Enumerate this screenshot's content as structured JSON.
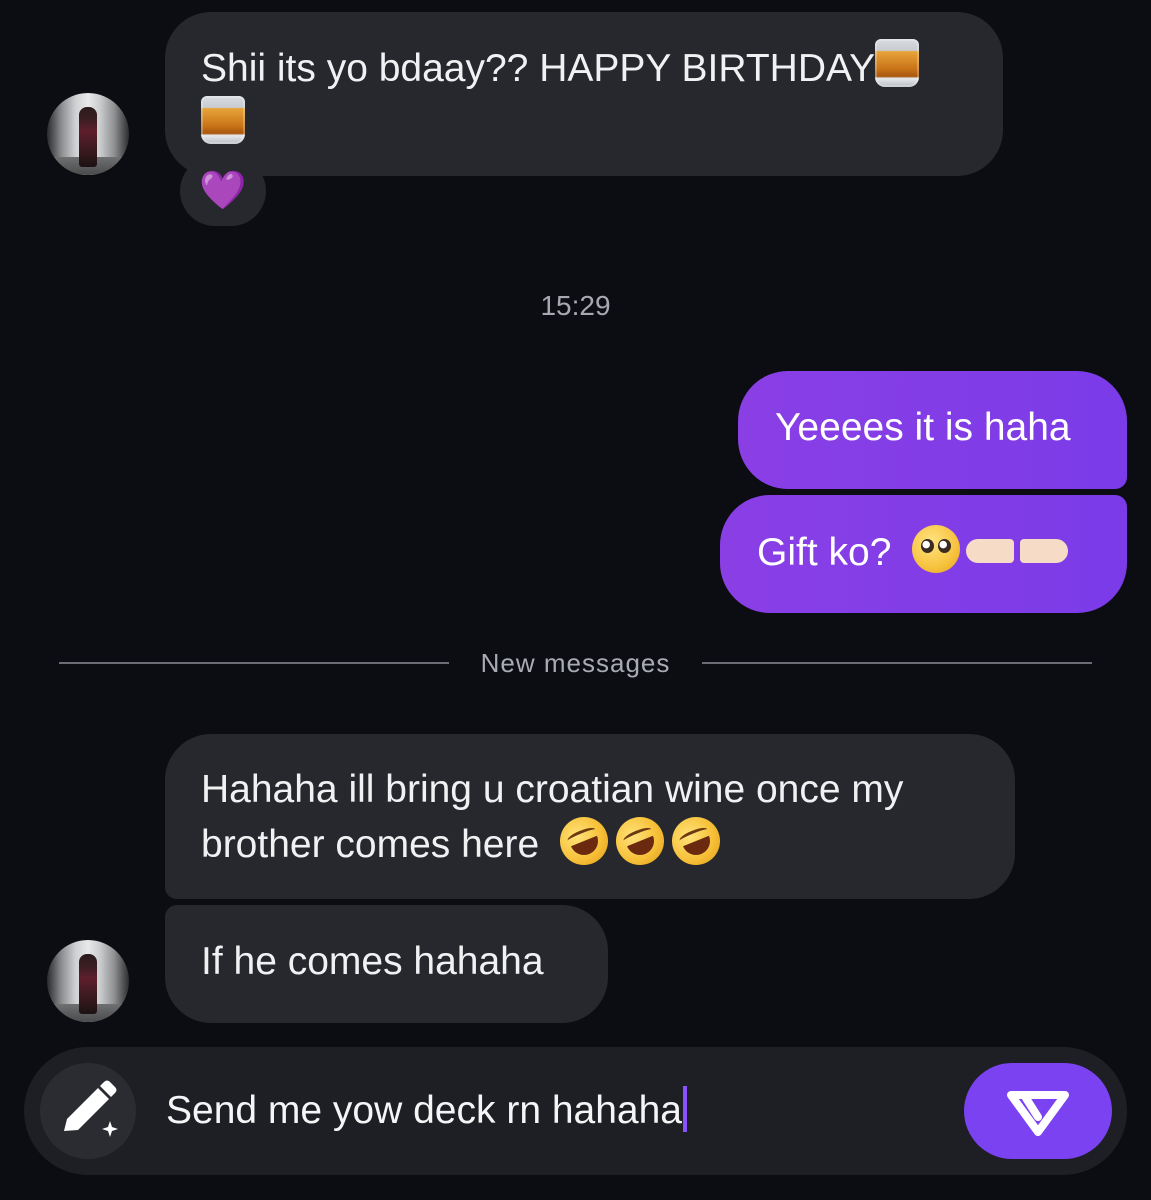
{
  "messages": {
    "msg1_line1": "Shii its yo bdaay?? HAPPY BIRTHDAY",
    "msg1_reaction": "💜",
    "timestamp": "15:29",
    "out1": "Yeeees it is haha",
    "out2": "Gift ko?",
    "new_messages_label": "New messages",
    "msg2_line1": "Hahaha ill bring u croatian wine once my",
    "msg2_line2": "brother comes here",
    "msg3": "If he comes hahaha"
  },
  "composer": {
    "text": "Send me yow deck rn hahaha"
  },
  "colors": {
    "background": "#0c0d12",
    "incoming_bubble": "#26282d",
    "outgoing_bubble": "#8a3fe5",
    "accent": "#7a42f0"
  },
  "icons": {
    "emoji_whiskey": "tumbler-glass-icon",
    "emoji_heart": "purple-heart-icon",
    "emoji_laugh": "rolling-on-floor-laughing-icon",
    "emoji_pleading": "pleading-face-icon",
    "emoji_pointing": "pointing-fingers-icon",
    "composer_left": "pencil-sparkle-icon",
    "composer_send": "send-paper-plane-icon"
  }
}
